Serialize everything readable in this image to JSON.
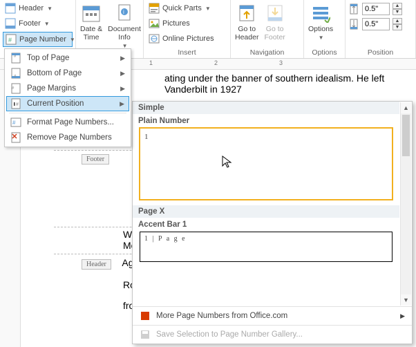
{
  "ribbon": {
    "hf": {
      "header": "Header",
      "footer": "Footer",
      "page_number": "Page Number"
    },
    "dt": {
      "date_time": "Date &\nTime",
      "doc_info": "Document\nInfo"
    },
    "insert": {
      "label": "Insert",
      "quick_parts": "Quick Parts",
      "pictures": "Pictures",
      "online_pictures": "Online Pictures"
    },
    "nav": {
      "label": "Navigation",
      "goto_header": "Go to\nHeader",
      "goto_footer": "Go to\nFooter"
    },
    "options": {
      "label": "Options",
      "btn": "Options"
    },
    "position": {
      "label": "Position",
      "top": "0.5\"",
      "bottom": "0.5\""
    }
  },
  "ruler": {
    "t1": "1",
    "t2": "2",
    "t3": "3"
  },
  "pn_menu": {
    "top": "Top of Page",
    "bottom": "Bottom of Page",
    "margins": "Page Margins",
    "current": "Current Position",
    "format": "Format Page Numbers...",
    "remove": "Remove Page Numbers"
  },
  "gallery": {
    "cat1": "Simple",
    "item1": "Plain Number",
    "cat2": "Page X",
    "item2": "Accent Bar 1",
    "sample2": "1 | P a g e",
    "more": "More Page Numbers from Office.com",
    "save": "Save Selection to Page Number Gallery..."
  },
  "doc": {
    "line1": "ating under the banner of southern idealism.  He left Vanderbilt in 1927",
    "footer_tag": "Footer",
    "name": "William",
    "date": "Monday",
    "header_tag": "Header",
    "line3a": "Agrarian",
    "line4": "Robert I",
    "line5": "from Va"
  }
}
